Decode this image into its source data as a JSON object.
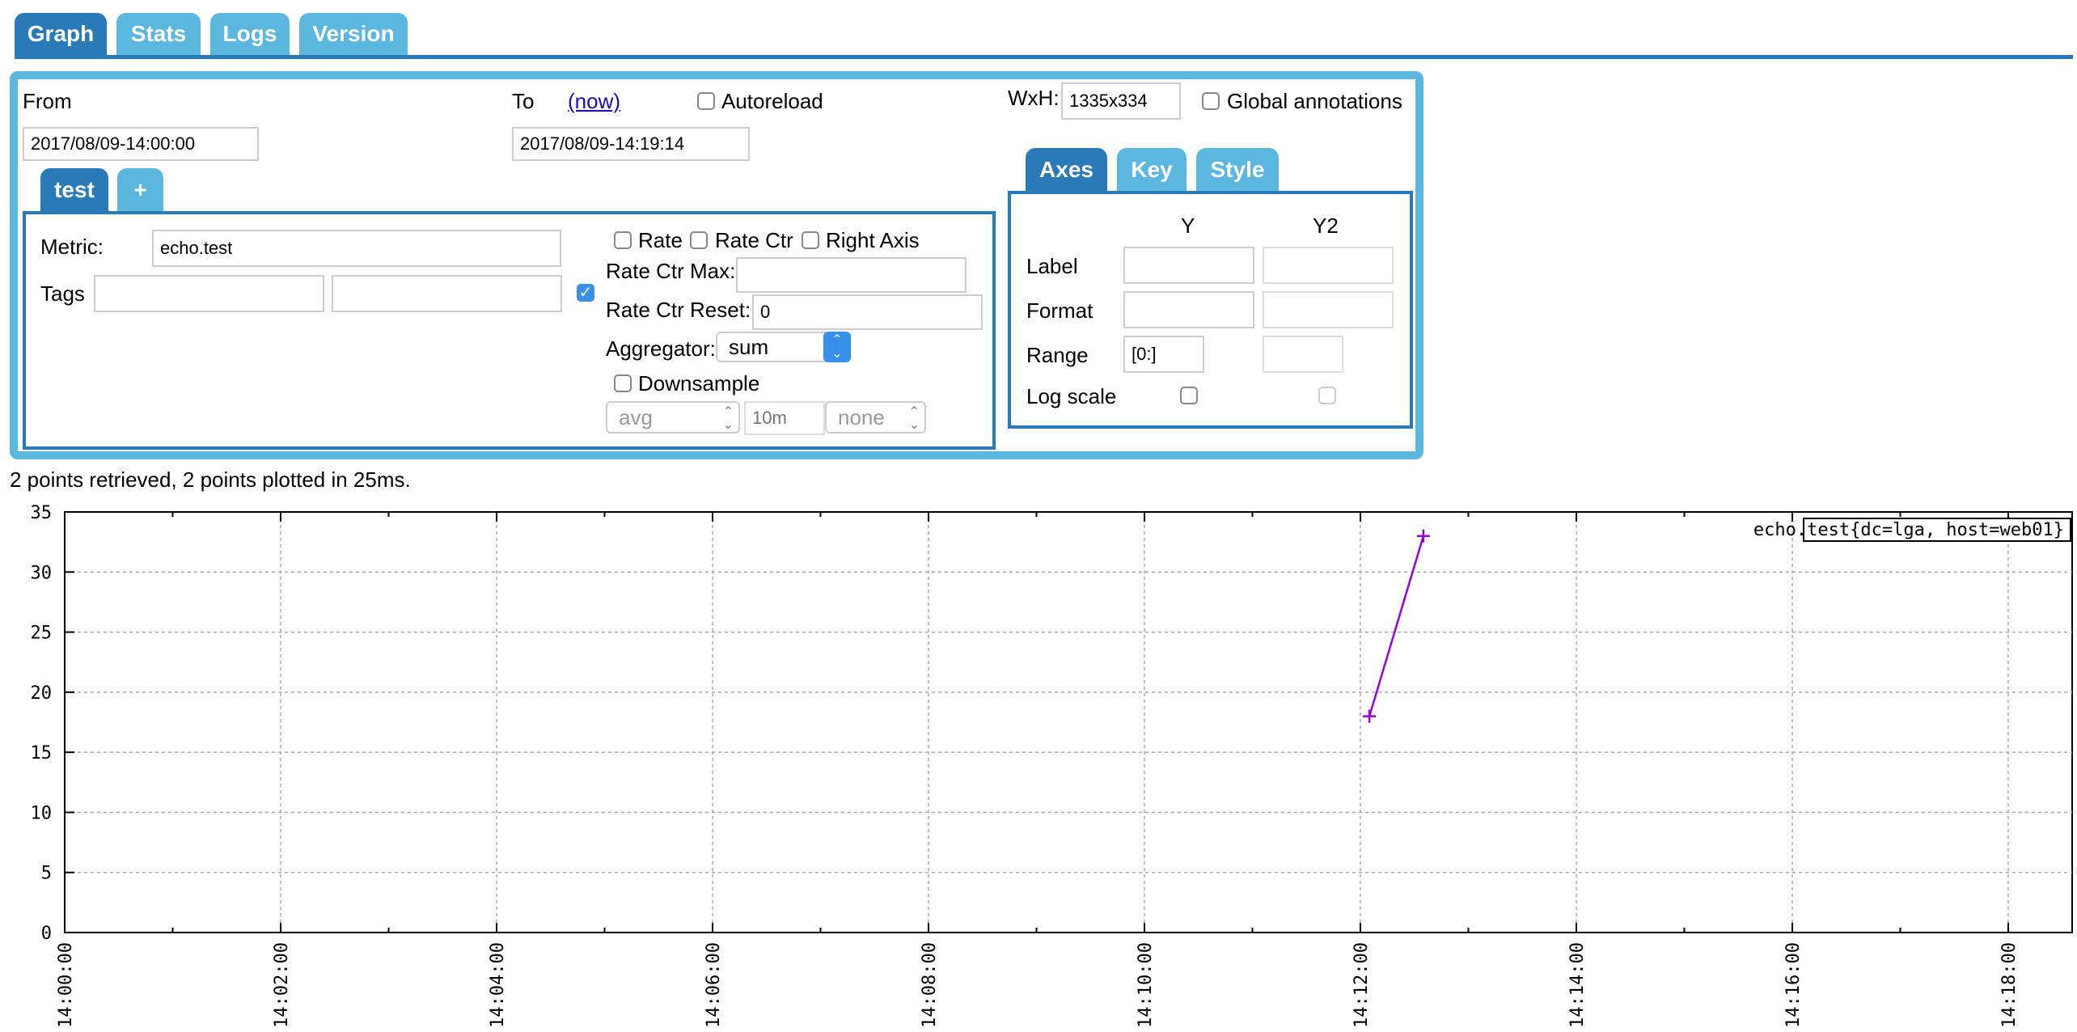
{
  "nav": {
    "tabs": [
      {
        "label": "Graph",
        "active": true
      },
      {
        "label": "Stats",
        "active": false
      },
      {
        "label": "Logs",
        "active": false
      },
      {
        "label": "Version",
        "active": false
      }
    ]
  },
  "query": {
    "from_label": "From",
    "from_value": "2017/08/09-14:00:00",
    "to_label": "To",
    "now_link": "(now)",
    "to_value": "2017/08/09-14:19:14",
    "autoreload_label": "Autoreload",
    "autoreload_checked": false,
    "wxh_label": "WxH:",
    "wxh_value": "1335x334",
    "global_annotations_label": "Global annotations",
    "global_annotations_checked": false
  },
  "metric_tabs": [
    {
      "label": "test",
      "active": true
    },
    {
      "label": "+",
      "active": false
    }
  ],
  "metric": {
    "metric_label": "Metric:",
    "metric_value": "echo.test",
    "tags_label": "Tags",
    "tag_key": "",
    "tag_value": "",
    "tag_checked": true,
    "rate_label": "Rate",
    "rate_ctr_label": "Rate Ctr",
    "right_axis_label": "Right Axis",
    "rate_ctr_max_label": "Rate Ctr Max:",
    "rate_ctr_max_value": "",
    "rate_ctr_reset_label": "Rate Ctr Reset:",
    "rate_ctr_reset_value": "0",
    "aggregator_label": "Aggregator:",
    "aggregator_value": "sum",
    "downsample_label": "Downsample",
    "downsample_checked": false,
    "downsample_func": "avg",
    "downsample_interval_placeholder": "10m",
    "downsample_fill": "none"
  },
  "axes_tabs": [
    {
      "label": "Axes",
      "active": true
    },
    {
      "label": "Key",
      "active": false
    },
    {
      "label": "Style",
      "active": false
    }
  ],
  "axes": {
    "y_header": "Y",
    "y2_header": "Y2",
    "label_row": "Label",
    "format_row": "Format",
    "range_row": "Range",
    "log_scale_row": "Log scale",
    "y_range_value": "[0:]",
    "y_label_value": "",
    "y_format_value": "",
    "y2_label_value": "",
    "y2_format_value": "",
    "y2_range_value": ""
  },
  "status": {
    "text": "2 points retrieved, 2 points plotted in 25ms."
  },
  "chart_data": {
    "type": "line",
    "title": "",
    "xlabel": "",
    "ylabel": "",
    "ylim": [
      0,
      35
    ],
    "yticks": [
      "0",
      "5",
      "10",
      "15",
      "20",
      "25",
      "30",
      "35"
    ],
    "xlim": [
      "14:00:00",
      "14:19:14"
    ],
    "xticks": [
      "14:00:00",
      "14:02:00",
      "14:04:00",
      "14:06:00",
      "14:08:00",
      "14:10:00",
      "14:12:00",
      "14:14:00",
      "14:16:00",
      "14:18:00"
    ],
    "grid": true,
    "legend_position": "top-right",
    "series": [
      {
        "name": "echo.test{dc=lga, host=web01}",
        "color": "#9400d3",
        "points": [
          {
            "x": "14:12:05",
            "y": 18
          },
          {
            "x": "14:12:35",
            "y": 33
          }
        ]
      }
    ]
  }
}
